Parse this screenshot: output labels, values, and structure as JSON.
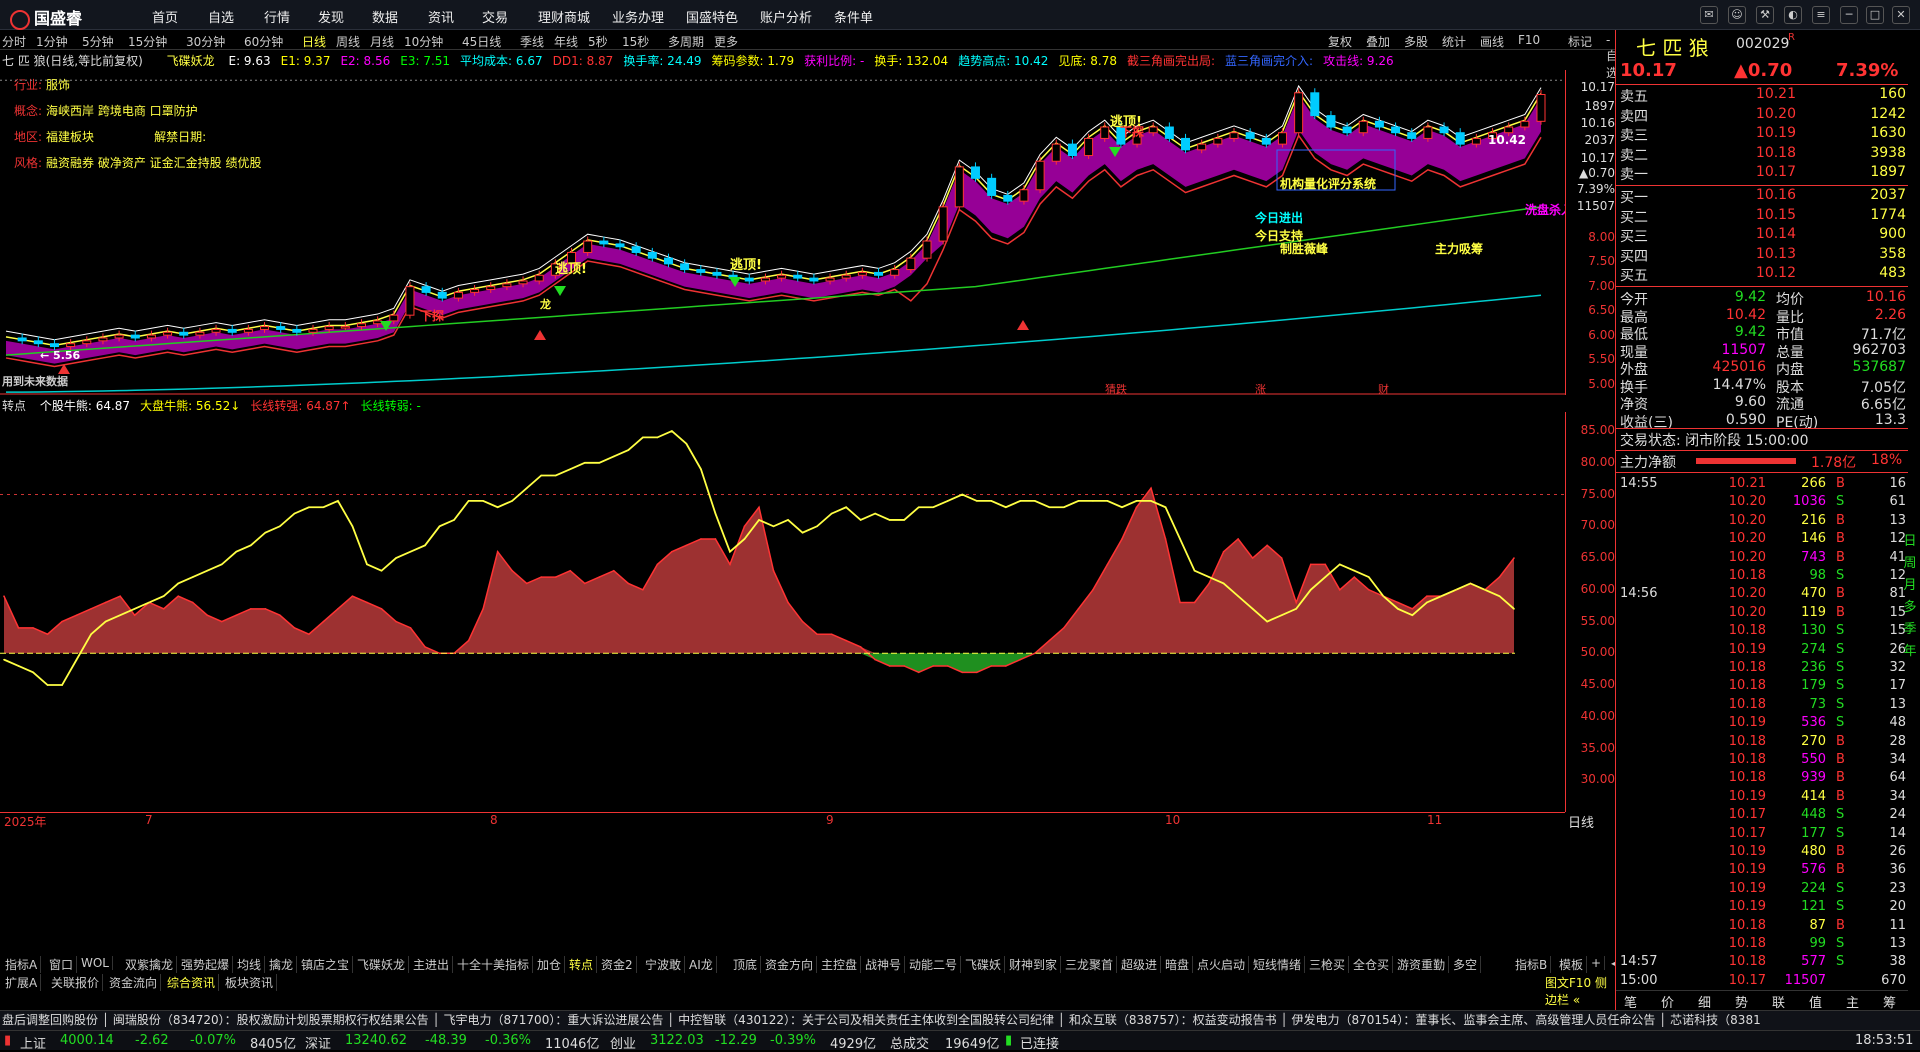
{
  "app": {
    "name": "国盛睿"
  },
  "menu": [
    "首页",
    "自选",
    "行情",
    "发现",
    "数据",
    "资讯",
    "交易",
    "理财商城",
    "业务办理",
    "国盛特色",
    "账户分析",
    "条件单"
  ],
  "periods": [
    "分时",
    "1分钟",
    "5分钟",
    "15分钟",
    "30分钟",
    "60分钟",
    "日线",
    "周线",
    "月线",
    "10分钟",
    "45日线",
    "季线",
    "年线",
    "5秒",
    "15秒",
    "多周期",
    "更多"
  ],
  "active_period": "日线",
  "tools": [
    "复权",
    "叠加",
    "多股",
    "统计",
    "画线",
    "F10",
    "标记",
    "-自选",
    "返回"
  ],
  "chart_header": {
    "title": "七 匹 狼(日线,等比前复权)",
    "indicator": "飞碟妖龙",
    "items": [
      {
        "label": "E: 9.63",
        "color": "#ffffff"
      },
      {
        "label": "E1: 9.37",
        "color": "#ffff00"
      },
      {
        "label": "E2: 8.56",
        "color": "#ff00ff"
      },
      {
        "label": "E3: 7.51",
        "color": "#00ff00"
      },
      {
        "label": "平均成本: 6.67",
        "color": "#00ffff"
      },
      {
        "label": "DD1: 8.87",
        "color": "#ff3333"
      },
      {
        "label": "换手率: 24.49",
        "color": "#00ffff"
      },
      {
        "label": "筹码参数: 1.79",
        "color": "#ffff00"
      },
      {
        "label": "获利比例: -",
        "color": "#ff00ff"
      },
      {
        "label": "换手: 132.04",
        "color": "#ffff00"
      },
      {
        "label": "趋势高点: 10.42",
        "color": "#00ffff"
      },
      {
        "label": "见底: 8.78",
        "color": "#ffff00"
      },
      {
        "label": "截三角画完出局:",
        "color": "#ff3333"
      },
      {
        "label": "蓝三角画完介入:",
        "color": "#3366ff"
      },
      {
        "label": "攻击线: 9.26",
        "color": "#ff00ff"
      }
    ]
  },
  "info_lines": [
    {
      "key": "行业:",
      "value": "服饰"
    },
    {
      "key": "概念:",
      "value": "海峡西岸 跨境电商 口罩防护"
    },
    {
      "key": "地区:",
      "value": "福建板块",
      "extra": "解禁日期:"
    },
    {
      "key": "风格:",
      "value": "融资融券 破净资产 证金汇金持股 绩优股"
    }
  ],
  "chart_annotations": {
    "escape_1": "逃顶!",
    "escape_2": "逃顶!",
    "escape_3": "逃顶!",
    "down_1": "下探",
    "down_2": "下探",
    "high_label": "10.42",
    "low_label": "← 5.56",
    "system": "机构量化评分系统",
    "today_flow": "今日进出",
    "today_support": "今日支持",
    "battle": "制胜薇峰",
    "main_buy": "主力吸筹",
    "wash": "洗盘杀入",
    "dragon": "龙",
    "future_data": "用到未来数据",
    "event_1": "猜跌",
    "event_2": "涨",
    "event_3": "财"
  },
  "main_yaxis": [
    "10.17",
    "1897",
    "10.16",
    "2037",
    "10.17",
    "▲0.70",
    "7.39%",
    "11507",
    "8.00",
    "7.50",
    "7.00",
    "6.50",
    "6.00",
    "5.50",
    "5.00"
  ],
  "sub_header": {
    "name": "转点",
    "items": [
      {
        "label": "个股牛熊: 64.87",
        "color": "#ffffff"
      },
      {
        "label": "大盘牛熊: 56.52↓",
        "color": "#ffff00"
      },
      {
        "label": "长线转强: 64.87↑",
        "color": "#ff3333"
      },
      {
        "label": "长线转弱: -",
        "color": "#00ff00"
      }
    ]
  },
  "sub_yaxis": [
    "85.00",
    "80.00",
    "75.00",
    "70.00",
    "65.00",
    "60.00",
    "55.00",
    "50.00",
    "45.00",
    "40.00",
    "35.00",
    "30.00"
  ],
  "xaxis": {
    "labels": [
      "2025年",
      "7",
      "8",
      "9",
      "10",
      "11"
    ],
    "mode": "日线"
  },
  "chart_data": {
    "type": "line",
    "sub_series": [
      {
        "name": "个股牛熊",
        "color": "#cc3333",
        "values": [
          59,
          54,
          54,
          53,
          55,
          56,
          57,
          58,
          59,
          56,
          58,
          57,
          59,
          58,
          56,
          55,
          56,
          57,
          57,
          56,
          54,
          53,
          55,
          57,
          59,
          58,
          57,
          55,
          54,
          51,
          50,
          50,
          52,
          57,
          66,
          63,
          61,
          62,
          62,
          63,
          61,
          62,
          63,
          61,
          60,
          64,
          66,
          67,
          68,
          68,
          64,
          70,
          73,
          63,
          58,
          55,
          53,
          53,
          52,
          51,
          49,
          48,
          48,
          47,
          48,
          48,
          47,
          47,
          48,
          48,
          49,
          50,
          52,
          54,
          57,
          60,
          64,
          68,
          73,
          76,
          68,
          58,
          58,
          61,
          66,
          68,
          65,
          67,
          65,
          58,
          64,
          64,
          60,
          62,
          60,
          59,
          58,
          57,
          59,
          59,
          60,
          61,
          60,
          62,
          65
        ]
      },
      {
        "name": "大盘牛熊",
        "color": "#ffff00",
        "values": [
          49,
          48,
          47,
          45,
          45,
          49,
          53,
          55,
          56,
          57,
          58,
          59,
          61,
          62,
          63,
          64,
          66,
          67,
          69,
          70,
          72,
          73,
          73,
          74,
          70,
          64,
          63,
          65,
          66,
          67,
          70,
          71,
          74,
          74,
          73,
          74,
          76,
          78,
          78,
          79,
          80,
          80,
          81,
          82,
          84,
          84,
          85,
          83,
          79,
          72,
          66,
          68,
          71,
          70,
          71,
          69,
          70,
          72,
          73,
          71,
          72,
          71,
          71,
          73,
          73,
          74,
          75,
          74,
          74,
          73,
          74,
          74,
          73,
          73,
          74,
          74,
          74,
          73,
          74,
          74,
          73,
          68,
          63,
          62,
          61,
          59,
          57,
          55,
          56,
          57,
          60,
          62,
          64,
          63,
          62,
          59,
          57,
          56,
          58,
          59,
          60,
          61,
          60,
          59,
          57
        ]
      }
    ],
    "sub_ylim": [
      25,
      88
    ],
    "baseline": 50,
    "dashed_level": 75,
    "main_ylim": [
      4.9,
      10.6
    ],
    "price_path": [
      5.9,
      5.85,
      5.8,
      5.75,
      5.8,
      5.85,
      5.9,
      5.95,
      5.9,
      5.95,
      6.0,
      5.95,
      6.0,
      6.05,
      6.0,
      6.05,
      6.1,
      6.05,
      6.0,
      6.05,
      6.1,
      6.1,
      6.15,
      6.2,
      6.3,
      6.8,
      6.7,
      6.6,
      6.7,
      6.75,
      6.8,
      6.85,
      6.9,
      7.0,
      7.2,
      7.4,
      7.6,
      7.55,
      7.5,
      7.4,
      7.3,
      7.2,
      7.1,
      7.05,
      7.0,
      6.95,
      6.9,
      6.95,
      7.0,
      6.95,
      6.9,
      6.95,
      7.0,
      7.05,
      7.0,
      7.1,
      7.3,
      7.6,
      8.2,
      8.9,
      8.7,
      8.4,
      8.3,
      8.5,
      9.0,
      9.3,
      9.1,
      9.4,
      9.6,
      9.3,
      9.5,
      9.6,
      9.4,
      9.2,
      9.3,
      9.4,
      9.5,
      9.4,
      9.3,
      9.5,
      10.2,
      9.8,
      9.6,
      9.5,
      9.7,
      9.6,
      9.5,
      9.4,
      9.6,
      9.5,
      9.3,
      9.4,
      9.5,
      9.6,
      9.7,
      10.17
    ]
  },
  "quote": {
    "name": "七 匹 狼",
    "code": "002029",
    "tag": "R",
    "price": "10.17",
    "change": "▲0.70",
    "pct": "7.39%",
    "asks": [
      {
        "lbl": "卖五",
        "price": "10.21",
        "vol": "160"
      },
      {
        "lbl": "卖四",
        "price": "10.20",
        "vol": "1242"
      },
      {
        "lbl": "卖三",
        "price": "10.19",
        "vol": "1630"
      },
      {
        "lbl": "卖二",
        "price": "10.18",
        "vol": "3938"
      },
      {
        "lbl": "卖一",
        "price": "10.17",
        "vol": "1897"
      }
    ],
    "bids": [
      {
        "lbl": "买一",
        "price": "10.16",
        "vol": "2037"
      },
      {
        "lbl": "买二",
        "price": "10.15",
        "vol": "1774"
      },
      {
        "lbl": "买三",
        "price": "10.14",
        "vol": "900"
      },
      {
        "lbl": "买四",
        "price": "10.13",
        "vol": "358"
      },
      {
        "lbl": "买五",
        "price": "10.12",
        "vol": "483"
      }
    ],
    "stats": [
      {
        "l1": "今开",
        "v1": "9.42",
        "c1": "grn",
        "l2": "均价",
        "v2": "10.16",
        "c2": "red"
      },
      {
        "l1": "最高",
        "v1": "10.42",
        "c1": "red",
        "l2": "量比",
        "v2": "2.26",
        "c2": "red"
      },
      {
        "l1": "最低",
        "v1": "9.42",
        "c1": "grn",
        "l2": "市值",
        "v2": "71.7亿",
        "c2": "wht"
      },
      {
        "l1": "现量",
        "v1": "11507",
        "c1": "mag",
        "l2": "总量",
        "v2": "962703",
        "c2": "wht"
      },
      {
        "l1": "外盘",
        "v1": "425016",
        "c1": "red",
        "l2": "内盘",
        "v2": "537687",
        "c2": "grn"
      },
      {
        "l1": "换手",
        "v1": "14.47%",
        "c1": "wht",
        "l2": "股本",
        "v2": "7.05亿",
        "c2": "wht"
      },
      {
        "l1": "净资",
        "v1": "9.60",
        "c1": "wht",
        "l2": "流通",
        "v2": "6.65亿",
        "c2": "wht"
      },
      {
        "l1": "收益(三)",
        "v1": "0.590",
        "c1": "wht",
        "l2": "PE(动)",
        "v2": "13.3",
        "c2": "wht"
      }
    ],
    "trade_state": "交易状态: 闭市阶段 15:00:00",
    "main_net_label": "主力净额",
    "main_net_value": "1.78亿",
    "main_net_pct": "18%",
    "ticks": [
      {
        "t": "14:55",
        "p": "10.21",
        "v": "266",
        "s": "B",
        "n": "16"
      },
      {
        "t": "",
        "p": "10.20",
        "v": "1036",
        "s": "S",
        "n": "61"
      },
      {
        "t": "",
        "p": "10.20",
        "v": "216",
        "s": "B",
        "n": "13"
      },
      {
        "t": "",
        "p": "10.20",
        "v": "146",
        "s": "B",
        "n": "12"
      },
      {
        "t": "",
        "p": "10.20",
        "v": "743",
        "s": "B",
        "n": "41"
      },
      {
        "t": "",
        "p": "10.18",
        "v": "98",
        "s": "S",
        "n": "12"
      },
      {
        "t": "14:56",
        "p": "10.20",
        "v": "470",
        "s": "B",
        "n": "81"
      },
      {
        "t": "",
        "p": "10.20",
        "v": "119",
        "s": "B",
        "n": "15"
      },
      {
        "t": "",
        "p": "10.18",
        "v": "130",
        "s": "S",
        "n": "15"
      },
      {
        "t": "",
        "p": "10.19",
        "v": "274",
        "s": "S",
        "n": "26"
      },
      {
        "t": "",
        "p": "10.18",
        "v": "236",
        "s": "S",
        "n": "32"
      },
      {
        "t": "",
        "p": "10.18",
        "v": "179",
        "s": "S",
        "n": "17"
      },
      {
        "t": "",
        "p": "10.18",
        "v": "73",
        "s": "S",
        "n": "13"
      },
      {
        "t": "",
        "p": "10.19",
        "v": "536",
        "s": "S",
        "n": "48"
      },
      {
        "t": "",
        "p": "10.18",
        "v": "270",
        "s": "B",
        "n": "28"
      },
      {
        "t": "",
        "p": "10.18",
        "v": "550",
        "s": "B",
        "n": "34"
      },
      {
        "t": "",
        "p": "10.18",
        "v": "939",
        "s": "B",
        "n": "64"
      },
      {
        "t": "",
        "p": "10.19",
        "v": "414",
        "s": "B",
        "n": "34"
      },
      {
        "t": "",
        "p": "10.17",
        "v": "448",
        "s": "S",
        "n": "24"
      },
      {
        "t": "",
        "p": "10.17",
        "v": "177",
        "s": "S",
        "n": "14"
      },
      {
        "t": "",
        "p": "10.19",
        "v": "480",
        "s": "B",
        "n": "26"
      },
      {
        "t": "",
        "p": "10.19",
        "v": "576",
        "s": "B",
        "n": "36"
      },
      {
        "t": "",
        "p": "10.19",
        "v": "224",
        "s": "S",
        "n": "23"
      },
      {
        "t": "",
        "p": "10.19",
        "v": "121",
        "s": "S",
        "n": "20"
      },
      {
        "t": "",
        "p": "10.18",
        "v": "87",
        "s": "B",
        "n": "11"
      },
      {
        "t": "",
        "p": "10.18",
        "v": "99",
        "s": "S",
        "n": "13"
      },
      {
        "t": "14:57",
        "p": "10.18",
        "v": "577",
        "s": "S",
        "n": "38"
      },
      {
        "t": "15:00",
        "p": "10.17",
        "v": "11507",
        "s": "",
        "n": "670"
      }
    ],
    "side_tabs": [
      "日",
      "周",
      "月",
      "多",
      "季",
      "年"
    ],
    "bottom_tabs": [
      "笔",
      "价",
      "细",
      "势",
      "联",
      "值",
      "主",
      "筹"
    ]
  },
  "bottom_tabs": [
    "指标A",
    "窗口",
    "WOL",
    "双紫擒龙",
    "强势起爆",
    "均线",
    "擒龙",
    "镇店之宝",
    "飞碟妖龙",
    "主进出",
    "十全十美指标",
    "加仓",
    "转点",
    "资金2",
    "宁波敢",
    "AI龙",
    "顶底",
    "资金方向",
    "主控盘",
    "战神号",
    "动能二号",
    "飞碟妖",
    "财神到家",
    "三龙聚首",
    "超级进",
    "暗盘",
    "点火启动",
    "短线情绪",
    "三枪买",
    "全仓买",
    "游资重勤",
    "多空"
  ],
  "bottom_tabs_2": [
    "扩展A",
    "关联报价",
    "资金流向",
    "综合资讯",
    "板块资讯"
  ],
  "bottom_right": [
    "指标B",
    "模板",
    "+",
    "◀",
    "▶",
    "✕"
  ],
  "side_label": "日线",
  "f10_link": "图文F10 侧边栏 «",
  "news": "盘后调整回购股份 │ 闽瑞股份（834720）：股权激励计划股票期权行权结果公告 │ 飞宇电力（871700）：重大诉讼进展公告 │ 中控智联（430122）：关于公司及相关责任主体收到全国股转公司纪律 │ 和众互联（838757）：权益变动报告书 │ 伊发电力（870154）：董事长、监事会主席、高级管理人员任命公告 │ 芯诺科技（8381",
  "status": {
    "sh_name": "上证",
    "sh": "4000.14",
    "sh_chg": "-2.62",
    "sh_pct": "-0.07%",
    "sh_amt": "8405亿",
    "sz_name": "深证",
    "sz": "13240.62",
    "sz_chg": "-48.39",
    "sz_pct": "-0.36%",
    "sz_amt": "11046亿",
    "cy_name": "创业",
    "cy": "3122.03",
    "cy_chg": "-12.29",
    "cy_pct": "-0.39%",
    "cy_amt": "4929亿",
    "total_label": "总成交",
    "total": "19649亿",
    "conn": "已连接",
    "time": "18:53:51"
  }
}
